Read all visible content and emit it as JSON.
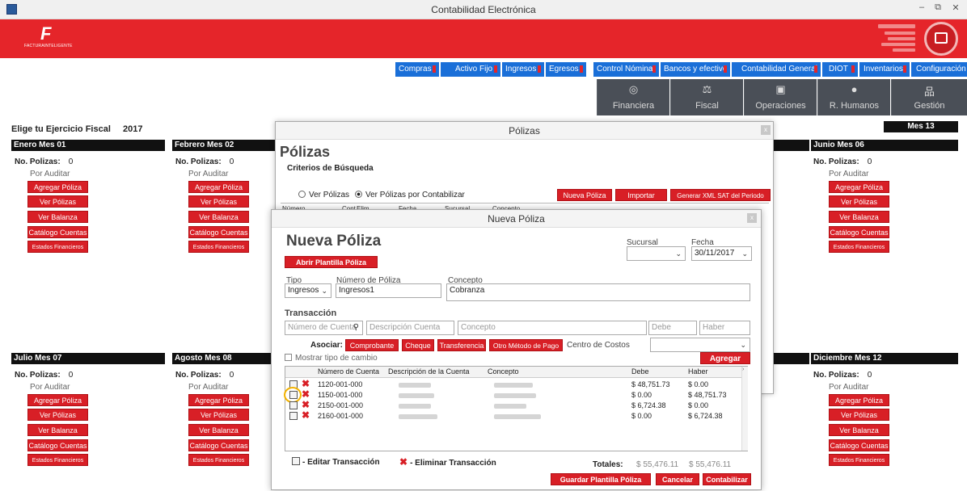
{
  "window": {
    "title": "Contabilidad Electrónica",
    "controls": [
      "–",
      "⧉",
      "✕"
    ]
  },
  "brand": {
    "logo_text": "FACTURAINTELIGENTE"
  },
  "top_nav": [
    {
      "label": "Compras"
    },
    {
      "label": "Activo Fijo"
    },
    {
      "label": "Ingresos"
    },
    {
      "label": "Egresos"
    },
    {
      "label": "Control Nómina"
    },
    {
      "label": "Bancos y efectivo"
    },
    {
      "label": "Contabilidad General"
    },
    {
      "label": "DIOT"
    },
    {
      "label": "Inventarios"
    },
    {
      "label": "Configuración"
    }
  ],
  "category_nav": [
    {
      "label": "Financiera",
      "icon": "coins-icon"
    },
    {
      "label": "Fiscal",
      "icon": "scales-icon"
    },
    {
      "label": "Operaciones",
      "icon": "clipboard-icon"
    },
    {
      "label": "R. Humanos",
      "icon": "person-icon"
    },
    {
      "label": "Gestión",
      "icon": "hierarchy-icon"
    }
  ],
  "fiscal_year": {
    "label": "Elige tu Ejercicio Fiscal",
    "value": "2017",
    "mes13": "Mes 13"
  },
  "month_common": {
    "polizas_label": "No. Polizas:",
    "status": "Por Auditar",
    "btn_agregar": "Agregar Póliza",
    "btn_ver": "Ver Pólizas",
    "btn_balanza": "Ver Balanza",
    "btn_catalogo": "Catálogo Cuentas",
    "btn_estados": "Estados Financieros"
  },
  "months": {
    "m01": {
      "title": "Enero Mes 01",
      "count": "0"
    },
    "m02": {
      "title": "Febrero Mes 02",
      "count": "0"
    },
    "m06": {
      "title": "Junio Mes 06",
      "count": "0"
    },
    "m07": {
      "title": "Julio Mes 07",
      "count": "0"
    },
    "m08": {
      "title": "Agosto Mes 08",
      "count": "0"
    },
    "m12": {
      "title": "Diciembre Mes 12",
      "count": "0"
    }
  },
  "polizas_window": {
    "title": "Pólizas",
    "heading": "Pólizas",
    "criteria": "Criterios de Búsqueda",
    "radio1": "Ver Pólizas",
    "radio2": "Ver Pólizas por Contabilizar",
    "btn_nueva": "Nueva Póliza",
    "btn_importar": "Importar",
    "btn_xml": "Generar XML SAT del Periodo",
    "cols": [
      "Número",
      "Cont",
      "Elim",
      "Fecha",
      "Sucursal",
      "Concepto"
    ]
  },
  "nueva_poliza": {
    "title": "Nueva Póliza",
    "heading": "Nueva Póliza",
    "btn_plantilla": "Abrir Plantilla Póliza",
    "sucursal_label": "Sucursal",
    "sucursal_value": "",
    "fecha_label": "Fecha",
    "fecha_value": "30/11/2017",
    "tipo_label": "Tipo",
    "tipo_value": "Ingresos",
    "numero_label": "Número de Póliza",
    "numero_value": "Ingresos1",
    "concepto_label": "Concepto",
    "concepto_value": "Cobranza",
    "transaccion_label": "Transacción",
    "ph_numero_cuenta": "Número de Cuenta",
    "ph_descripcion": "Descripción Cuenta",
    "ph_concepto": "Concepto",
    "ph_debe": "Debe",
    "ph_haber": "Haber",
    "asociar_label": "Asociar:",
    "btn_comprobante": "Comprobante",
    "btn_cheque": "Cheque",
    "btn_transferencia": "Transferencia",
    "btn_otro": "Otro Método de Pago",
    "centro_costos_label": "Centro de Costos",
    "mostrar_tipo_cambio": "Mostrar tipo de cambio",
    "btn_agregar": "Agregar",
    "grid_headers": [
      "Número de Cuenta",
      "Descripción de la Cuenta",
      "Concepto",
      "Debe",
      "Haber"
    ],
    "rows": [
      {
        "cuenta": "1120-001-000",
        "debe": "$ 48,751.73",
        "haber": "$ 0.00"
      },
      {
        "cuenta": "1150-001-000",
        "debe": "$ 0.00",
        "haber": "$ 48,751.73"
      },
      {
        "cuenta": "2150-001-000",
        "debe": "$ 6,724.38",
        "haber": "$ 0.00"
      },
      {
        "cuenta": "2160-001-000",
        "debe": "$ 0.00",
        "haber": "$ 6,724.38"
      }
    ],
    "legend_edit": "- Editar Transacción",
    "legend_delete": "- Eliminar Transacción",
    "totales_label": "Totales:",
    "total_debe": "$ 55,476.11",
    "total_haber": "$ 55,476.11",
    "btn_guardar_plantilla": "Guardar Plantilla Póliza",
    "btn_cancelar": "Cancelar",
    "btn_contabilizar": "Contabilizar"
  }
}
